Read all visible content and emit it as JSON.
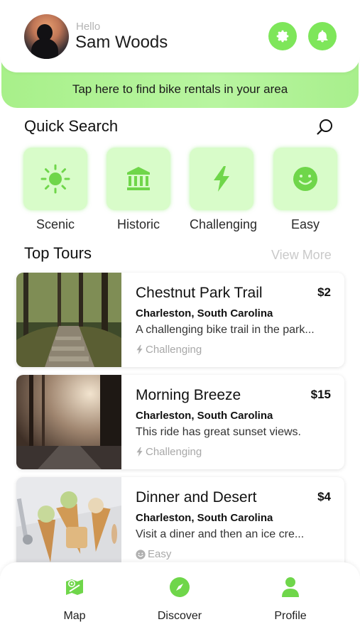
{
  "header": {
    "greeting": "Hello",
    "username": "Sam Woods",
    "banner_text": "Tap here to find bike rentals in your area"
  },
  "quick_search": {
    "title": "Quick Search",
    "categories": [
      {
        "label": "Scenic",
        "icon": "sun-icon"
      },
      {
        "label": "Historic",
        "icon": "museum-icon"
      },
      {
        "label": "Challenging",
        "icon": "lightning-icon"
      },
      {
        "label": "Easy",
        "icon": "smile-icon"
      }
    ]
  },
  "top_tours": {
    "title": "Top Tours",
    "view_more": "View More",
    "tours": [
      {
        "title": "Chestnut Park Trail",
        "price": "$2",
        "location": "Charleston, South Carolina",
        "description": "A challenging bike trail in the park...",
        "difficulty": "Challenging",
        "difficulty_icon": "lightning-icon"
      },
      {
        "title": "Morning Breeze",
        "price": "$15",
        "location": "Charleston, South Carolina",
        "description": "This ride has great sunset views.",
        "difficulty": "Challenging",
        "difficulty_icon": "lightning-icon"
      },
      {
        "title": "Dinner and Desert",
        "price": "$4",
        "location": "Charleston, South Carolina",
        "description": "Visit a diner and then an ice cre...",
        "difficulty": "Easy",
        "difficulty_icon": "smile-icon"
      }
    ]
  },
  "bottom_nav": {
    "items": [
      {
        "label": "Map",
        "icon": "map-icon"
      },
      {
        "label": "Discover",
        "icon": "compass-icon"
      },
      {
        "label": "Profile",
        "icon": "person-icon"
      }
    ]
  },
  "colors": {
    "accent": "#7ee65a",
    "tile_bg": "#d8fcc9",
    "banner": "#b0f296"
  }
}
